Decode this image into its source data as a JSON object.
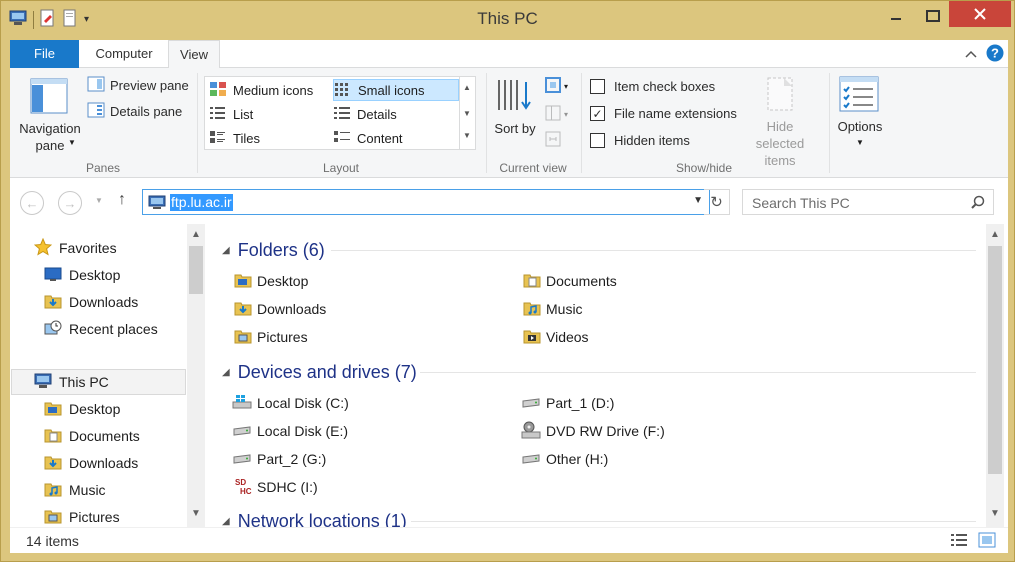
{
  "window": {
    "title": "This PC"
  },
  "ribbon": {
    "tabs": [
      "File",
      "Computer",
      "View"
    ],
    "panes_group": {
      "navigation_pane_label": "Navigation pane",
      "preview_pane_label": "Preview pane",
      "details_pane_label": "Details pane",
      "group_label": "Panes"
    },
    "layout_group": {
      "items": [
        "Medium icons",
        "Small icons",
        "List",
        "Details",
        "Tiles",
        "Content"
      ],
      "selected": "Small icons",
      "group_label": "Layout"
    },
    "current_view_group": {
      "sort_by_label": "Sort by",
      "group_label": "Current view"
    },
    "show_hide_group": {
      "item_check_boxes": {
        "label": "Item check boxes",
        "checked": false
      },
      "file_name_extensions": {
        "label": "File name extensions",
        "checked": true
      },
      "hidden_items": {
        "label": "Hidden items",
        "checked": false
      },
      "hide_selected_items_label": "Hide selected items",
      "group_label": "Show/hide"
    },
    "options_label": "Options"
  },
  "address": {
    "path": "ftp.lu.ac.ir",
    "search_placeholder": "Search This PC"
  },
  "nav_pane": {
    "favorites": {
      "label": "Favorites",
      "items": [
        "Desktop",
        "Downloads",
        "Recent places"
      ]
    },
    "this_pc": {
      "label": "This PC",
      "items": [
        "Desktop",
        "Documents",
        "Downloads",
        "Music",
        "Pictures"
      ]
    }
  },
  "content": {
    "folders": {
      "title": "Folders (6)",
      "items": [
        "Desktop",
        "Documents",
        "Downloads",
        "Music",
        "Pictures",
        "Videos"
      ]
    },
    "devices": {
      "title": "Devices and drives (7)",
      "items": [
        "Local Disk (C:)",
        "Part_1 (D:)",
        "Local Disk (E:)",
        "DVD RW Drive (F:)",
        "Part_2 (G:)",
        "Other (H:)",
        "SDHC (I:)"
      ]
    },
    "network": {
      "title": "Network locations (1)"
    }
  },
  "status": {
    "item_count": "14 items"
  },
  "colors": {
    "title_bar": "#dcc67e",
    "file_tab": "#1979ca",
    "close_button": "#c9453a",
    "selection": "#3399ff",
    "section_title": "#1e3287"
  }
}
